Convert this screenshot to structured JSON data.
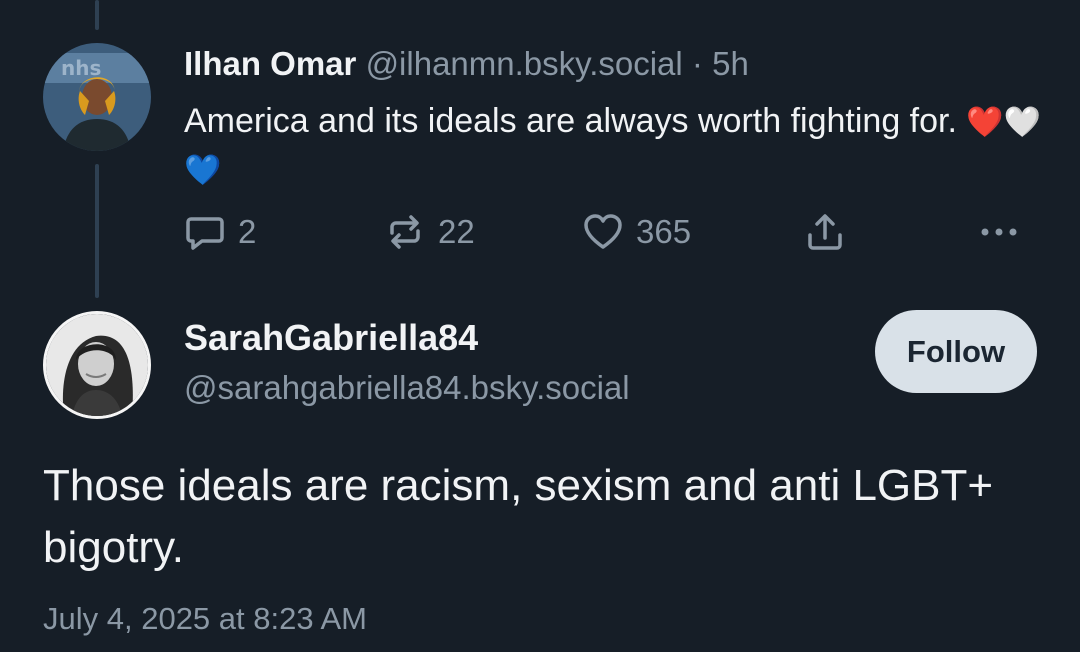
{
  "parent_post": {
    "author_name": "Ilhan Omar",
    "author_handle": "@ilhanmn.bsky.social",
    "separator": "·",
    "time_ago": "5h",
    "text": "America and its ideals are always worth fighting for.",
    "emojis": "❤️🤍💙",
    "reply_count": "2",
    "repost_count": "22",
    "like_count": "365",
    "icons": {
      "reply": "reply-icon",
      "repost": "repost-icon",
      "like": "heart-icon",
      "share": "share-icon",
      "more": "more-icon"
    }
  },
  "reply_post": {
    "author_name": "SarahGabriella84",
    "author_handle": "@sarahgabriella84.bsky.social",
    "follow_label": "Follow",
    "text": "Those ideals are racism, sexism and anti LGBT+ bigotry.",
    "timestamp": "July 4, 2025 at 8:23 AM"
  },
  "colors": {
    "background": "#161e27",
    "primary_text": "#f1f3f5",
    "secondary_text": "#8b98a5",
    "thread_line": "#2e4052",
    "follow_button": "#d9e1e8"
  }
}
